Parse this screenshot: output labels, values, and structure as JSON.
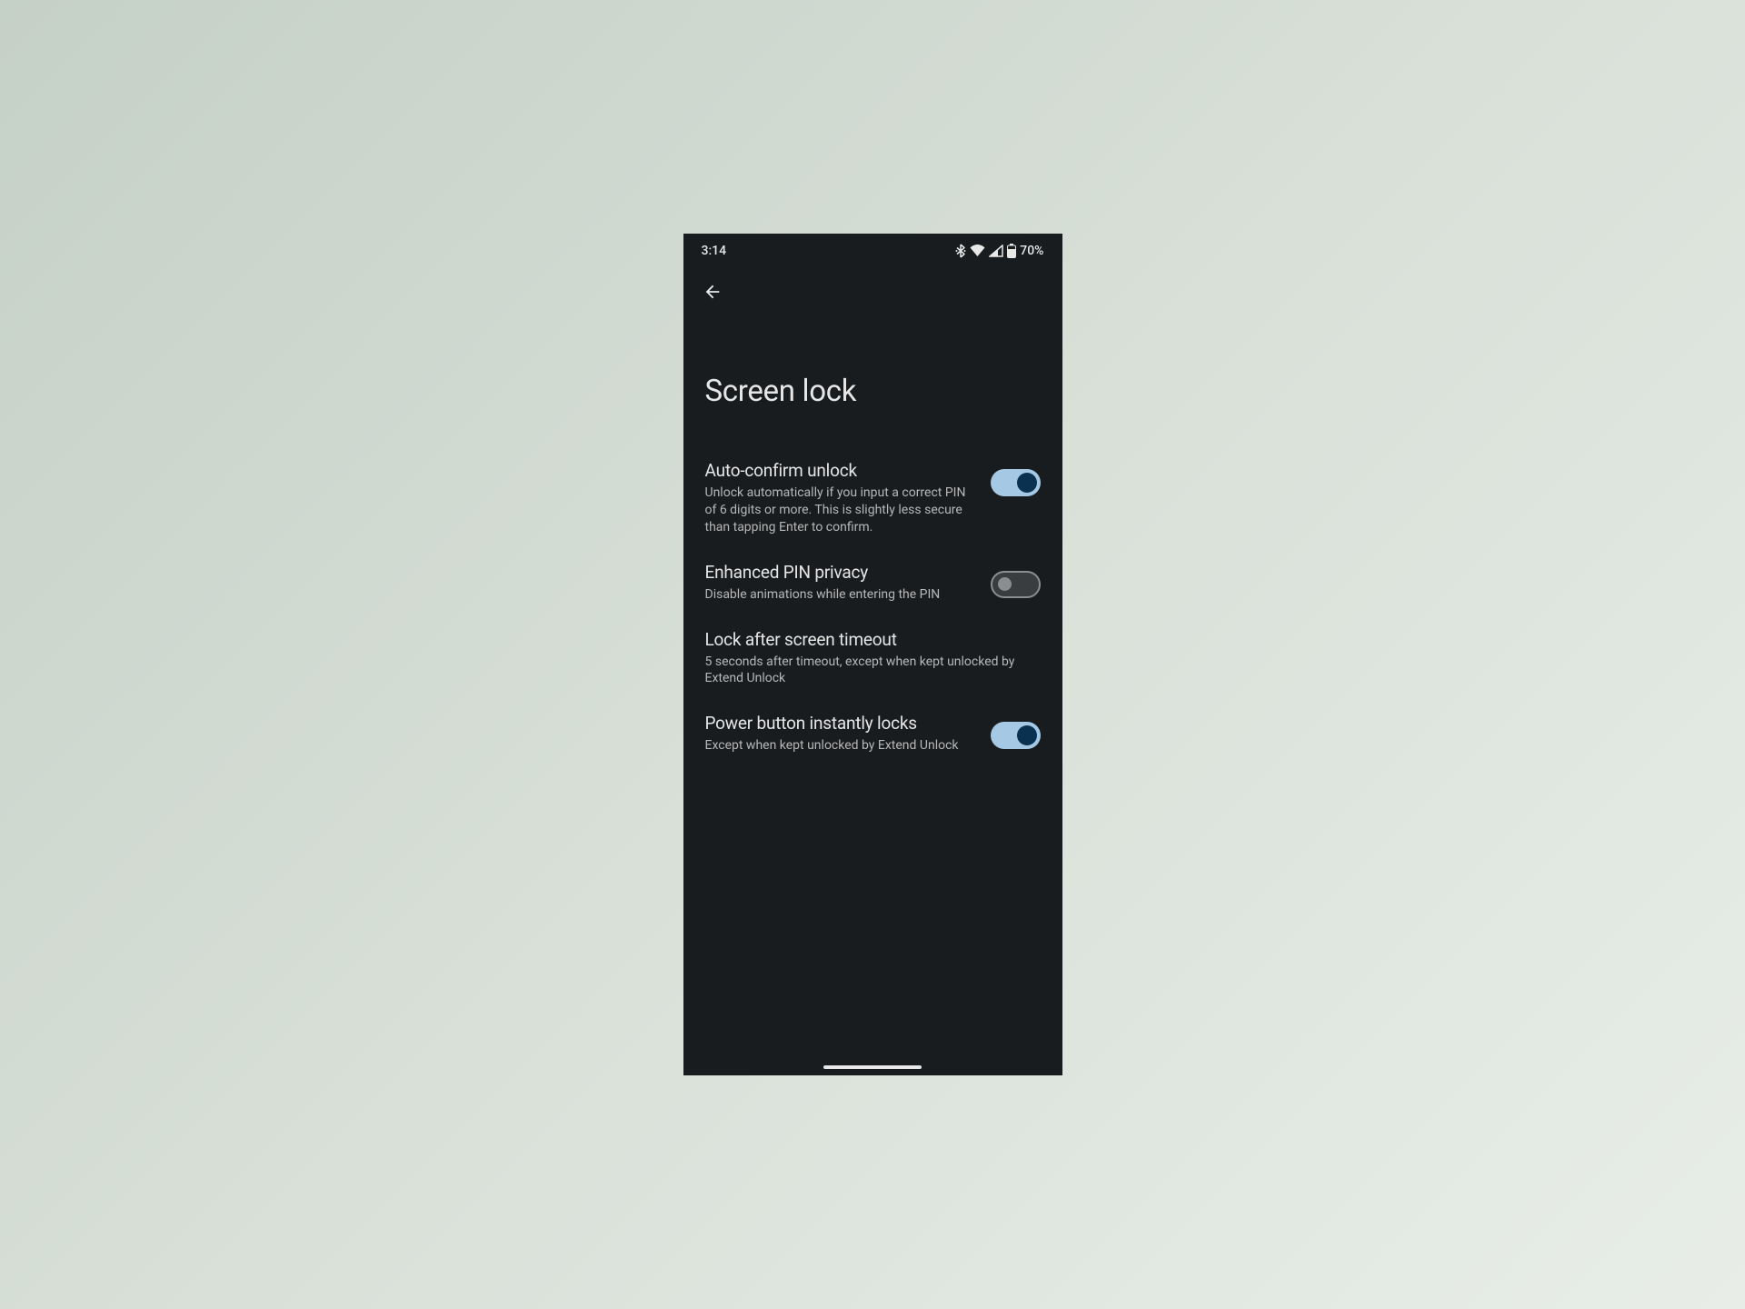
{
  "statusBar": {
    "time": "3:14",
    "battery": "70%"
  },
  "pageTitle": "Screen lock",
  "settings": [
    {
      "title": "Auto-confirm unlock",
      "desc": "Unlock automatically if you input a correct PIN of 6 digits or more. This is slightly less secure than tapping Enter to confirm.",
      "toggle": true,
      "toggleOn": true
    },
    {
      "title": "Enhanced PIN privacy",
      "desc": "Disable animations while entering the PIN",
      "toggle": true,
      "toggleOn": false
    },
    {
      "title": "Lock after screen timeout",
      "desc": "5 seconds after timeout, except when kept unlocked by Extend Unlock",
      "toggle": false
    },
    {
      "title": "Power button instantly locks",
      "desc": "Except when kept unlocked by Extend Unlock",
      "toggle": true,
      "toggleOn": true
    }
  ]
}
